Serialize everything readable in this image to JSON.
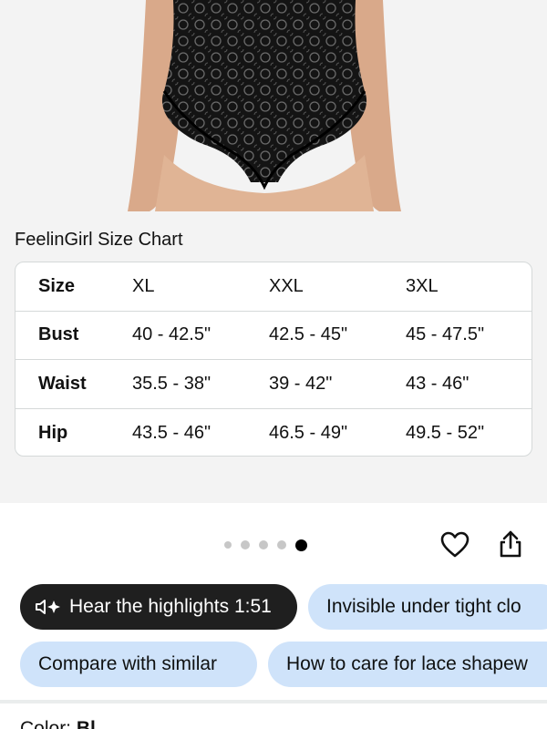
{
  "size_chart": {
    "title": "FeelinGirl Size Chart",
    "header": [
      "Size",
      "XL",
      "XXL",
      "3XL"
    ],
    "rows": [
      [
        "Bust",
        "40 - 42.5\"",
        "42.5 - 45\"",
        "45 - 47.5\""
      ],
      [
        "Waist",
        "35.5 - 38\"",
        "39 - 42\"",
        "43 - 46\""
      ],
      [
        "Hip",
        "43.5 - 46\"",
        "46.5 - 49\"",
        "49.5 - 52\""
      ]
    ]
  },
  "gallery": {
    "image_count": 5,
    "active_index": 5
  },
  "chips": {
    "hear_highlights": "Hear the highlights 1:51",
    "invisible": "Invisible under tight clo",
    "compare": "Compare with similar",
    "care": "How to care for lace shapew"
  },
  "color": {
    "label": "Color: ",
    "value": "Bl"
  },
  "colors": {
    "chip_blue": "#cfe3fa",
    "chip_dark": "#1f1f1f",
    "gallery_bg": "#f3f3f3"
  }
}
